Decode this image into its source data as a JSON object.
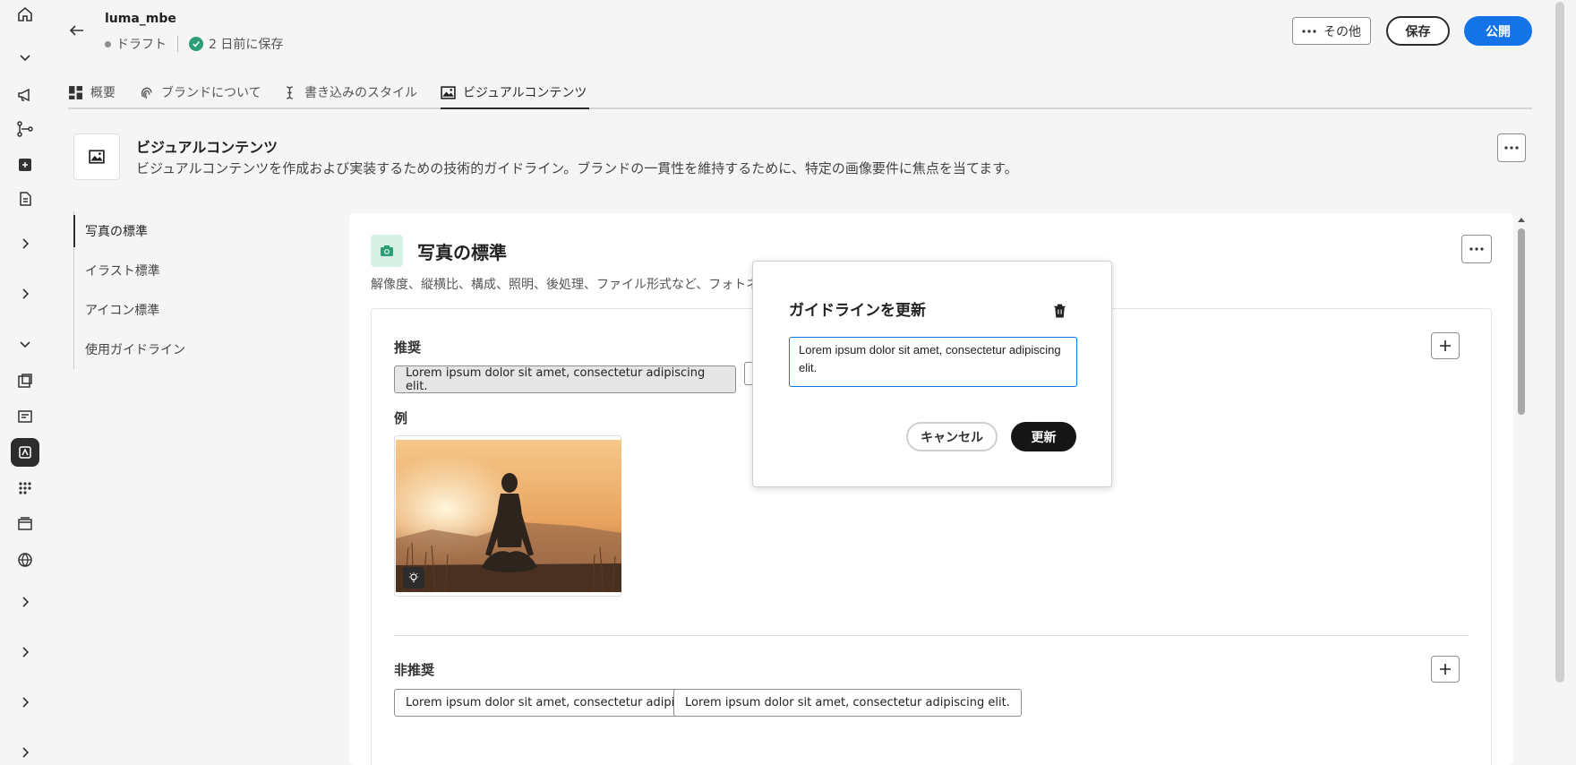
{
  "header": {
    "title": "luma_mbe",
    "status_draft": "ドラフト",
    "status_saved": "2 日前に保存",
    "more_label": "その他",
    "save_label": "保存",
    "publish_label": "公開"
  },
  "tabs": [
    {
      "label": "概要",
      "icon": "dashboard-icon"
    },
    {
      "label": "ブランドについて",
      "icon": "fingerprint-icon"
    },
    {
      "label": "書き込みのスタイル",
      "icon": "text-cursor-icon"
    },
    {
      "label": "ビジュアルコンテンツ",
      "icon": "image-icon",
      "active": true
    }
  ],
  "section": {
    "title": "ビジュアルコンテンツ",
    "description": "ビジュアルコンテンツを作成および実装するための技術的ガイドライン。ブランドの一貫性を維持するために、特定の画像要件に焦点を当てます。"
  },
  "subnav": [
    {
      "label": "写真の標準",
      "active": true
    },
    {
      "label": "イラスト標準"
    },
    {
      "label": "アイコン標準"
    },
    {
      "label": "使用ガイドライン"
    }
  ],
  "panel": {
    "title": "写真の標準",
    "description": "解像度、縦横比、構成、照明、後処理、ファイル形式など、フォトネ",
    "recommended_label": "推奨",
    "recommended_items": [
      "Lorem ipsum dolor sit amet, consectetur adipiscing elit."
    ],
    "example_label": "例",
    "not_recommended_label": "非推奨",
    "not_recommended_items": [
      "Lorem ipsum dolor sit amet, consectetur adipiscing elit.",
      "Lorem ipsum dolor sit amet, consectetur adipiscing elit."
    ]
  },
  "popover": {
    "title": "ガイドラインを更新",
    "text_value": "Lorem ipsum dolor sit amet, consectetur adipiscing elit.",
    "cancel_label": "キャンセル",
    "update_label": "更新"
  },
  "colors": {
    "accent": "#1473e6",
    "success": "#2d9d78",
    "dark": "#161616"
  }
}
